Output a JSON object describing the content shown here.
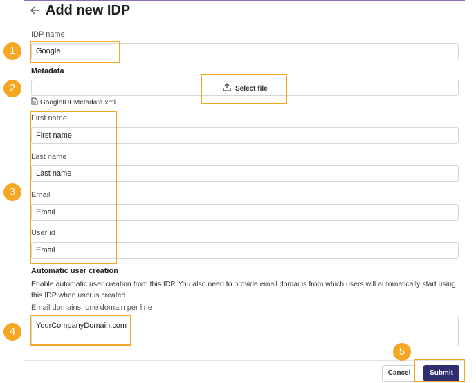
{
  "header": {
    "title": "Add new IDP"
  },
  "idp_name": {
    "label": "IDP name",
    "value": "Google"
  },
  "metadata": {
    "label": "Metadata",
    "select_label": "Select file",
    "file_name": "GoogleIDPMetadata.xml"
  },
  "first_name": {
    "label": "First name",
    "value": "First name"
  },
  "last_name": {
    "label": "Last name",
    "value": "Last name"
  },
  "email": {
    "label": "Email",
    "value": "Email"
  },
  "user_id": {
    "label": "User id",
    "value": "Email"
  },
  "auto_creation": {
    "heading": "Automatic user creation",
    "description": "Enable automatic user creation from this IDP. You also need to provide email domains from which users will automatically start using this IDP when user is created.",
    "domains_label": "Email domains, one domain per line",
    "domains_value": "YourCompanyDomain.com"
  },
  "footer": {
    "cancel_label": "Cancel",
    "submit_label": "Submit"
  },
  "callouts": [
    "1",
    "2",
    "3",
    "4",
    "5"
  ],
  "colors": {
    "accent": "#f5a623",
    "primary_button": "#2e2d6e"
  }
}
